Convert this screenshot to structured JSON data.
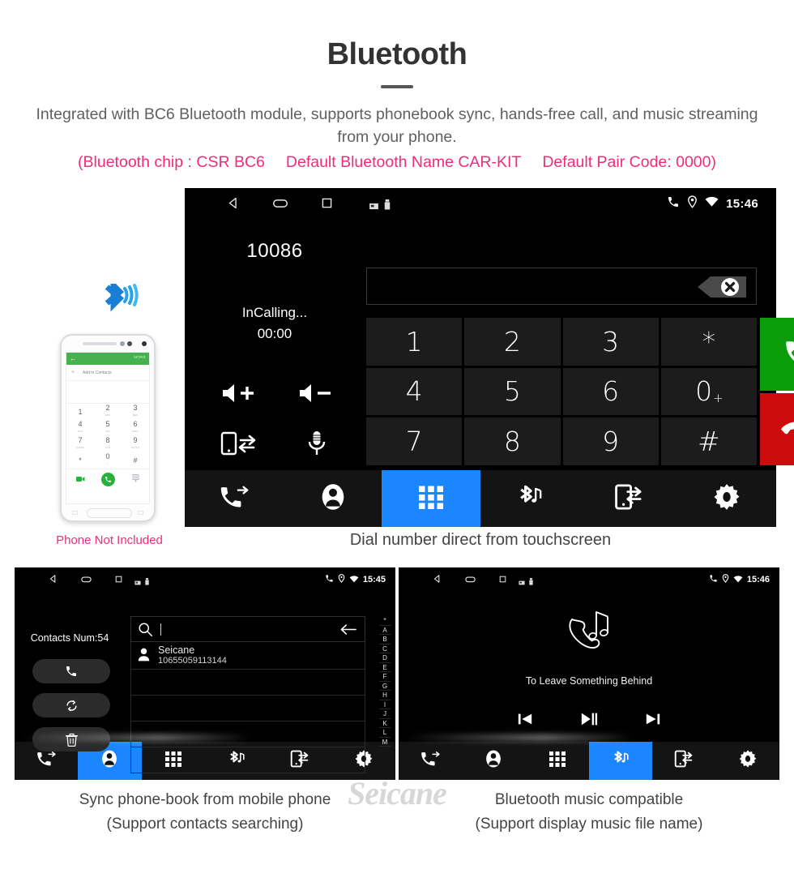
{
  "header": {
    "title": "Bluetooth",
    "subtitle": "Integrated with BC6 Bluetooth module, supports phonebook sync, hands-free call, and music streaming from your phone.",
    "spec_chip": "(Bluetooth chip : CSR BC6",
    "spec_name": "Default Bluetooth Name CAR-KIT",
    "spec_pair": "Default Pair Code: 0000)",
    "accent_pink": "#ee2d7a",
    "title_color": "#333333"
  },
  "phone_illustration": {
    "bluetooth_icon": "bluetooth-icon",
    "screen": {
      "back_label": "←",
      "more_label": "MORE",
      "add_contact_plus": "+",
      "add_contact_label": "Add to Contacts",
      "keys": [
        {
          "d": "1",
          "s": ""
        },
        {
          "d": "2",
          "s": "ABC"
        },
        {
          "d": "3",
          "s": "DEF"
        },
        {
          "d": "4",
          "s": "GHI"
        },
        {
          "d": "5",
          "s": "JKL"
        },
        {
          "d": "6",
          "s": "MNO"
        },
        {
          "d": "7",
          "s": "PQRS"
        },
        {
          "d": "8",
          "s": "TUV"
        },
        {
          "d": "9",
          "s": "WXYZ"
        },
        {
          "d": "*",
          "s": ""
        },
        {
          "d": "0",
          "s": "+"
        },
        {
          "d": "#",
          "s": ""
        }
      ]
    },
    "caption": "Phone Not Included"
  },
  "dialer": {
    "statusbar": {
      "back_icon": "back-triangle-icon",
      "home_icon": "home-oval-icon",
      "recents_icon": "recents-square-icon",
      "sd_icon": "sdcard-icon",
      "usb_icon": "usb-icon",
      "phone_icon": "phone-icon",
      "gps_icon": "location-pin-icon",
      "wifi_icon": "wifi-icon",
      "time": "15:46"
    },
    "call": {
      "number": "10086",
      "state": "InCalling...",
      "duration": "00:00"
    },
    "controls": [
      {
        "name": "volume-up-icon",
        "label": "Volume Up"
      },
      {
        "name": "volume-down-icon",
        "label": "Volume Down"
      },
      {
        "name": "transfer-to-phone-icon",
        "label": "Transfer To Phone"
      },
      {
        "name": "microphone-mute-icon",
        "label": "Microphone"
      }
    ],
    "input_value": "",
    "backspace_icon": "backspace-clear-icon",
    "keys": [
      {
        "main": "1",
        "sub": ""
      },
      {
        "main": "2",
        "sub": ""
      },
      {
        "main": "3",
        "sub": ""
      },
      {
        "main": "*",
        "sub": ""
      },
      {
        "main": "4",
        "sub": ""
      },
      {
        "main": "5",
        "sub": ""
      },
      {
        "main": "6",
        "sub": ""
      },
      {
        "main": "0",
        "sub": "+"
      },
      {
        "main": "7",
        "sub": ""
      },
      {
        "main": "8",
        "sub": ""
      },
      {
        "main": "9",
        "sub": ""
      },
      {
        "main": "#",
        "sub": ""
      }
    ],
    "accept_button": "call-accept-button",
    "reject_button": "call-reject-button",
    "accept_color": "#0a9c0a",
    "reject_color": "#cc0c0c",
    "caption": "Dial number direct from touchscreen"
  },
  "navbar": {
    "active_color": "#1a86ff",
    "items": [
      {
        "name": "nav-call-history",
        "label": "Call History"
      },
      {
        "name": "nav-contacts",
        "label": "Contacts"
      },
      {
        "name": "nav-keypad",
        "label": "Keypad"
      },
      {
        "name": "nav-bluetooth-music",
        "label": "Bluetooth Music"
      },
      {
        "name": "nav-phone-transfer",
        "label": "Phone"
      },
      {
        "name": "nav-settings",
        "label": "Settings"
      }
    ],
    "active_dialer": 2,
    "active_contacts": 1,
    "active_music": 3
  },
  "contacts_panel": {
    "time": "15:45",
    "contacts_num_label": "Contacts Num:54",
    "buttons": [
      {
        "name": "contacts-call-button",
        "label": "Call"
      },
      {
        "name": "contacts-sync-button",
        "label": "Sync"
      },
      {
        "name": "contacts-delete-button",
        "label": "Delete"
      }
    ],
    "search_placeholder": "",
    "search_value": "",
    "back_arrow": "←",
    "contacts": [
      {
        "name": "Seicane",
        "number": "10655059113144"
      }
    ],
    "alpha_index": [
      "*",
      "A",
      "B",
      "C",
      "D",
      "E",
      "F",
      "G",
      "H",
      "I",
      "J",
      "K",
      "L",
      "M"
    ],
    "caption_line1": "Sync phone-book from mobile phone",
    "caption_line2": "(Support contacts searching)"
  },
  "music_panel": {
    "time": "15:46",
    "now_playing": "To Leave Something Behind",
    "controls": [
      {
        "name": "prev-track-button",
        "label": "Previous"
      },
      {
        "name": "play-pause-button",
        "label": "Play / Pause"
      },
      {
        "name": "next-track-button",
        "label": "Next"
      }
    ],
    "caption_line1": "Bluetooth music compatible",
    "caption_line2": "(Support display music file name)"
  },
  "watermark": "Seicane"
}
